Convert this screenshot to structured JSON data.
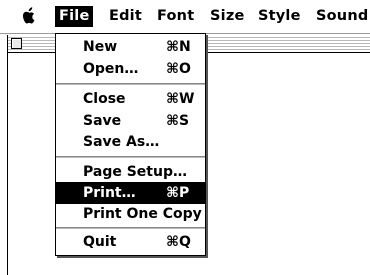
{
  "menubar": {
    "apple_icon": "apple-menu-icon",
    "items": [
      {
        "label": "File"
      },
      {
        "label": "Edit"
      },
      {
        "label": "Font"
      },
      {
        "label": "Size"
      },
      {
        "label": "Style"
      },
      {
        "label": "Sound"
      }
    ]
  },
  "file_menu": {
    "items": [
      {
        "label": "New",
        "shortcut": "⌘N"
      },
      {
        "label": "Open…",
        "shortcut": "⌘O"
      },
      {
        "label": "Close",
        "shortcut": "⌘W"
      },
      {
        "label": "Save",
        "shortcut": "⌘S"
      },
      {
        "label": "Save As…",
        "shortcut": ""
      },
      {
        "label": "Page Setup…",
        "shortcut": ""
      },
      {
        "label": "Print…",
        "shortcut": "⌘P",
        "highlighted": true
      },
      {
        "label": "Print One Copy",
        "shortcut": ""
      },
      {
        "label": "Quit",
        "shortcut": "⌘Q"
      }
    ]
  },
  "colors": {
    "highlight": "#000000",
    "menu_background": "#ffffff"
  }
}
